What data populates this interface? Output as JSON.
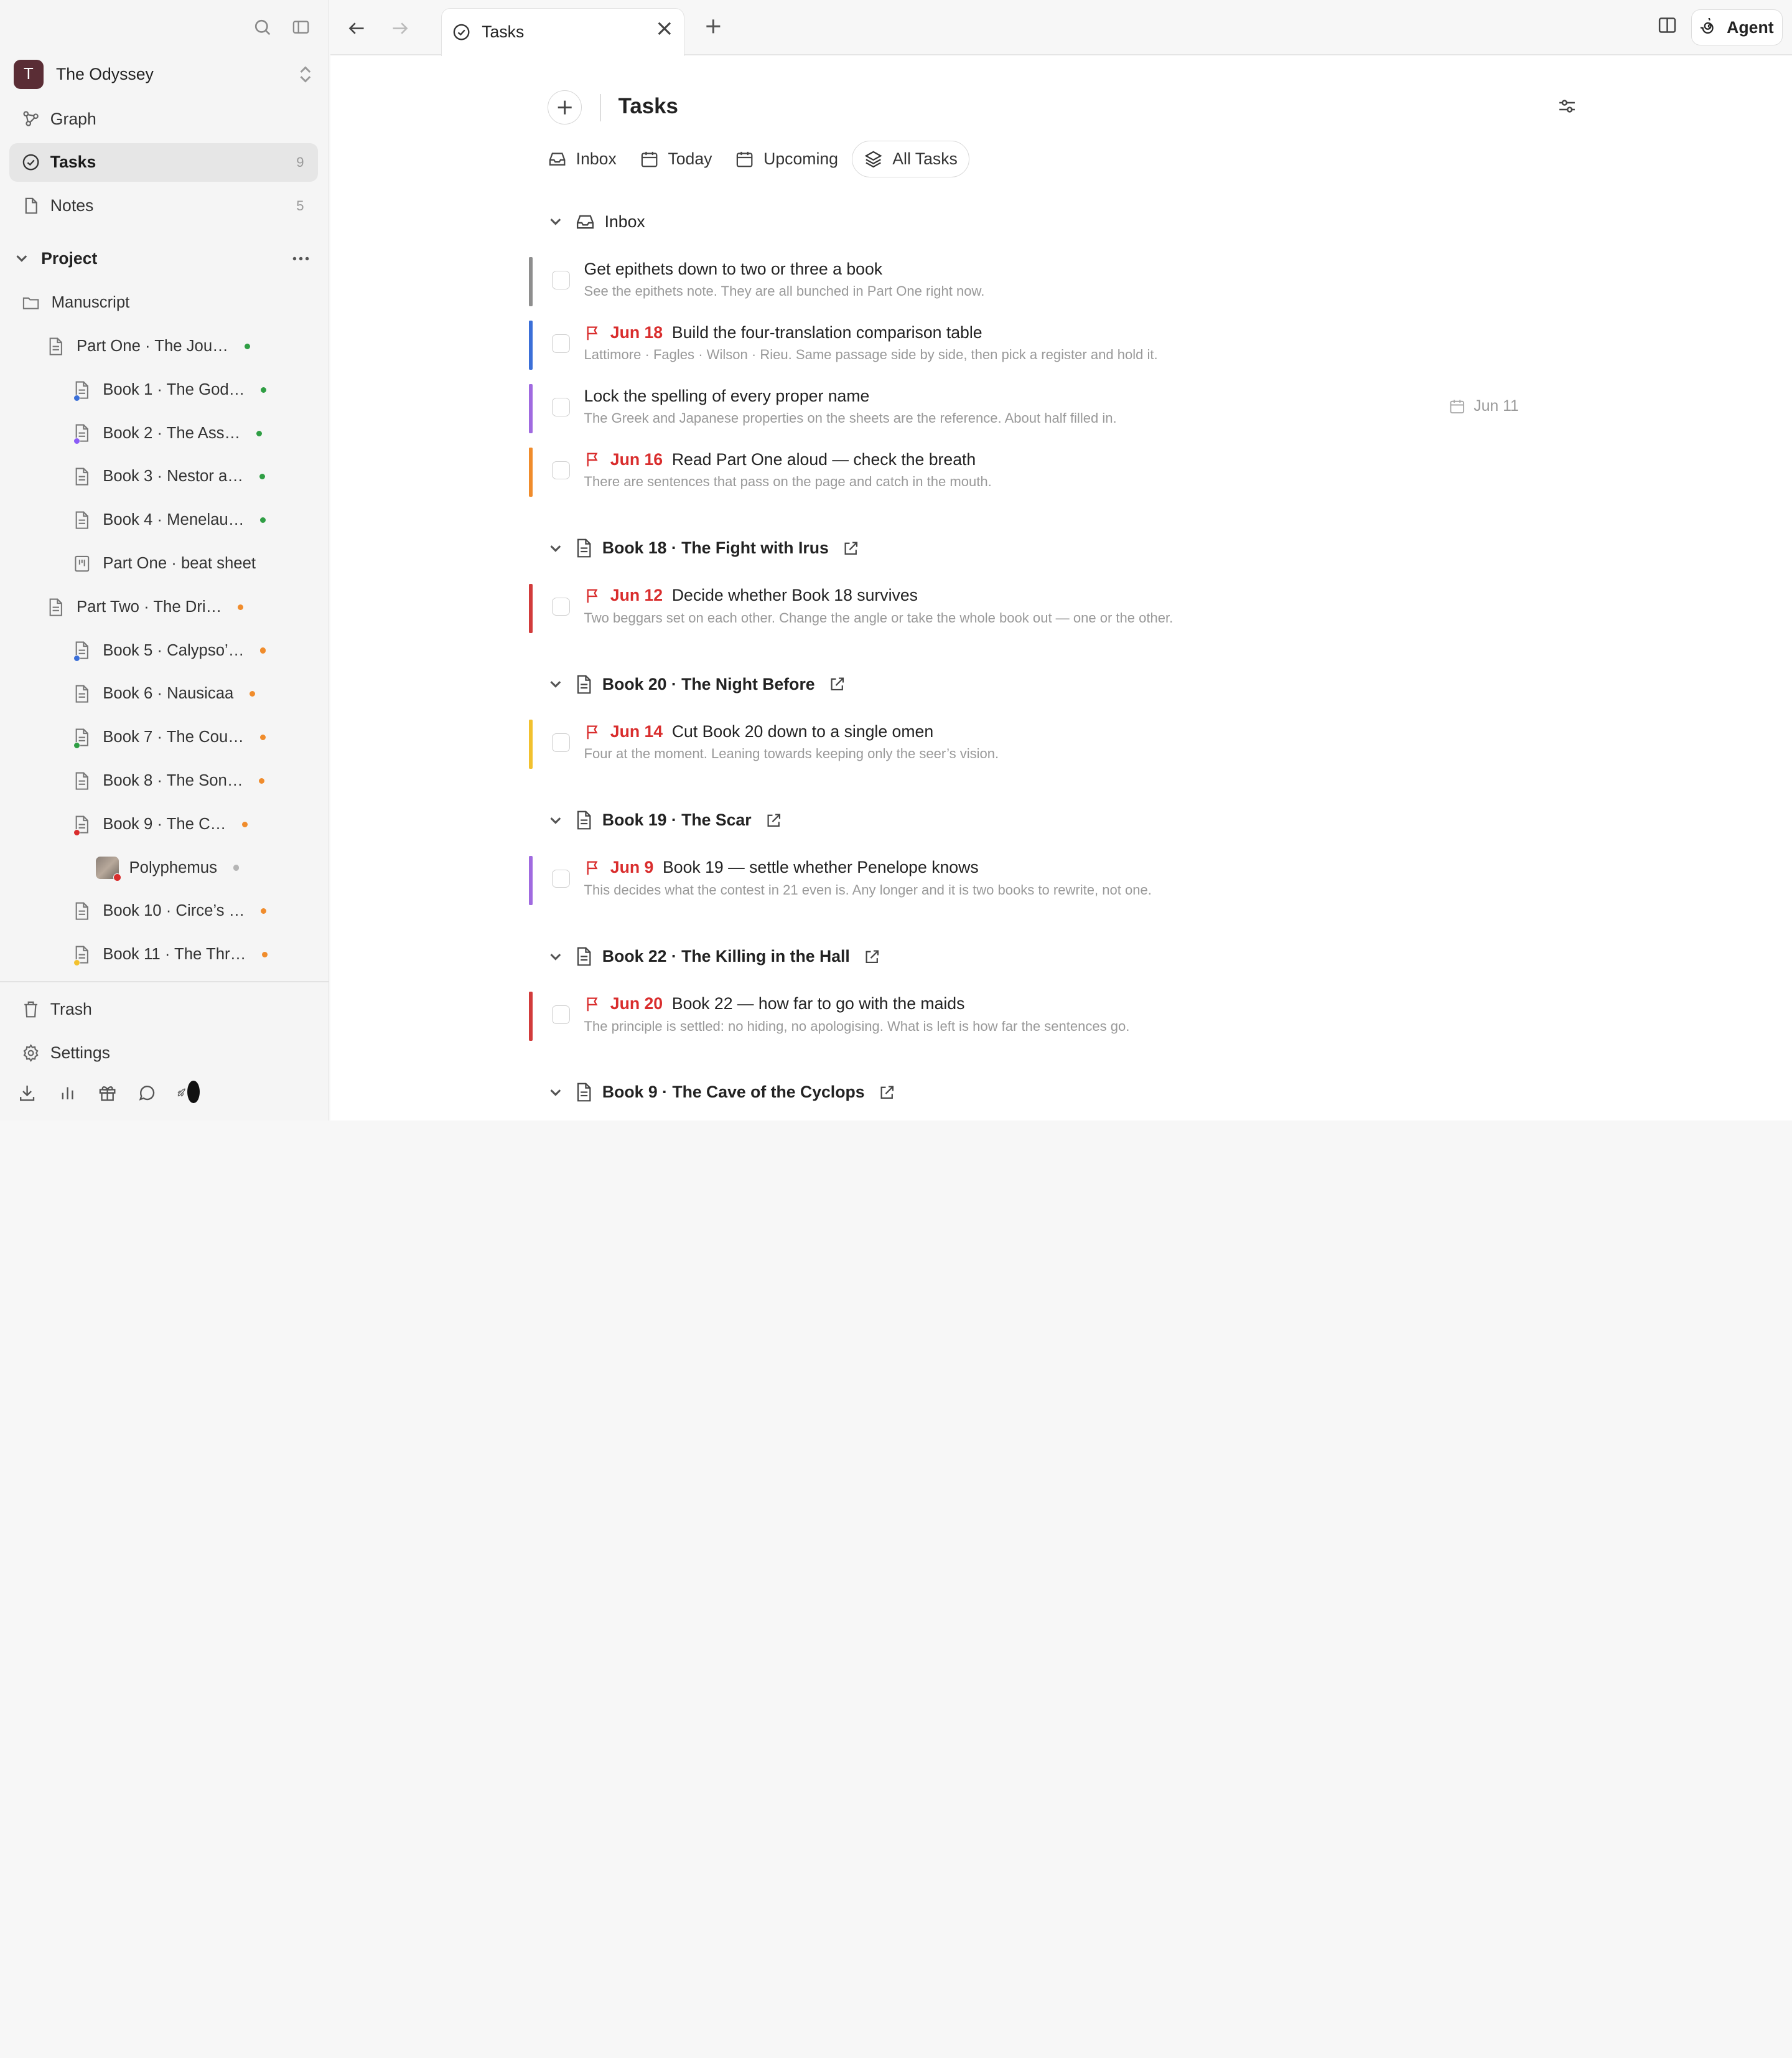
{
  "workspace": {
    "initial": "T",
    "name": "The Odyssey"
  },
  "nav": {
    "graph": "Graph",
    "tasks": {
      "label": "Tasks",
      "count": "9"
    },
    "notes": {
      "label": "Notes",
      "count": "5"
    }
  },
  "project": {
    "label": "Project",
    "tree": [
      {
        "label": "Manuscript",
        "icon": "folder-icon"
      },
      {
        "label": "Part One · The Jou…",
        "status_color": "#2f9e44",
        "icon": "document-icon"
      },
      {
        "label": "Book 1 · The God…",
        "status_color": "#2f9e44",
        "sub_color": "#3b6fd8",
        "icon": "document-icon"
      },
      {
        "label": "Book 2 · The Ass…",
        "status_color": "#2f9e44",
        "sub_color": "#8b5cf6",
        "icon": "document-icon"
      },
      {
        "label": "Book 3 · Nestor a…",
        "status_color": "#2f9e44",
        "icon": "document-icon"
      },
      {
        "label": "Book 4 · Menelau…",
        "status_color": "#2f9e44",
        "icon": "document-icon"
      },
      {
        "label": "Part One · beat sheet",
        "icon": "board-icon"
      },
      {
        "label": "Part Two · The Dri…",
        "status_color": "#f08c2c",
        "icon": "document-icon"
      },
      {
        "label": "Book 5 · Calypso’…",
        "status_color": "#f08c2c",
        "sub_color": "#3b6fd8",
        "icon": "document-icon"
      },
      {
        "label": "Book 6 · Nausicaa",
        "status_color": "#f08c2c",
        "icon": "document-icon"
      },
      {
        "label": "Book 7 · The Cou…",
        "status_color": "#f08c2c",
        "sub_color": "#2f9e44",
        "icon": "document-icon"
      },
      {
        "label": "Book 8 · The Son…",
        "status_color": "#f08c2c",
        "icon": "document-icon"
      },
      {
        "label": "Book 9 · The C…",
        "status_color": "#f08c2c",
        "sub_color": "#d92d2d",
        "icon": "document-icon"
      },
      {
        "label": "Polyphemus",
        "status_color": "#b5b5b5",
        "sub_color": "#d92d2d",
        "icon": "image-thumbnail"
      },
      {
        "label": "Book 10 · Circe’s …",
        "status_color": "#f08c2c",
        "icon": "document-icon"
      },
      {
        "label": "Book 11 · The Thr…",
        "status_color": "#f08c2c",
        "sub_color": "#f2c12e",
        "icon": "document-icon"
      }
    ]
  },
  "sidebar_bottom": {
    "trash": "Trash",
    "settings": "Settings"
  },
  "topbar": {
    "tab_title": "Tasks",
    "agent": "Agent"
  },
  "main": {
    "title": "Tasks",
    "views": [
      "Inbox",
      "Today",
      "Upcoming",
      "All Tasks"
    ],
    "groups": [
      {
        "title": "Inbox",
        "tasks": [
          {
            "title": "Get epithets down to two or three a book",
            "desc": "See the epithets note. They are all bunched in Part One right now.",
            "bar": "#8e8e8e"
          },
          {
            "due": "Jun 18",
            "title": "Build the four-translation comparison table",
            "desc": "Lattimore · Fagles · Wilson · Rieu. Same passage side by side, then pick a register and hold it.",
            "bar": "#3b6fd8"
          },
          {
            "title": "Lock the spelling of every proper name",
            "desc": "The Greek and Japanese properties on the sheets are the reference. About half filled in.",
            "bar": "#a06ae0",
            "date_right": "Jun 11"
          },
          {
            "due": "Jun 16",
            "title": "Read Part One aloud — check the breath",
            "desc": "There are sentences that pass on the page and catch in the mouth.",
            "bar": "#f08c2c"
          }
        ]
      },
      {
        "title": "Book 18 · The Fight with Irus",
        "tasks": [
          {
            "due": "Jun 12",
            "title": "Decide whether Book 18 survives",
            "desc": "Two beggars set on each other. Change the angle or take the whole book out — one or the other.",
            "bar": "#d23b3b"
          }
        ]
      },
      {
        "title": "Book 20 · The Night Before",
        "tasks": [
          {
            "due": "Jun 14",
            "title": "Cut Book 20 down to a single omen",
            "desc": "Four at the moment. Leaning towards keeping only the seer’s vision.",
            "bar": "#f2c12e"
          }
        ]
      },
      {
        "title": "Book 19 · The Scar",
        "tasks": [
          {
            "due": "Jun 9",
            "title": "Book 19 — settle whether Penelope knows",
            "desc": "This decides what the contest in 21 even is. Any longer and it is two books to rewrite, not one.",
            "bar": "#a06ae0"
          }
        ]
      },
      {
        "title": "Book 22 · The Killing in the Hall",
        "tasks": [
          {
            "due": "Jun 20",
            "title": "Book 22 — how far to go with the maids",
            "desc": "The principle is settled: no hiding, no apologising. What is left is how far the sentences go.",
            "bar": "#d23b3b"
          }
        ]
      },
      {
        "title": "Book 9 · The Cave of the Cyclops",
        "tasks": []
      }
    ]
  }
}
